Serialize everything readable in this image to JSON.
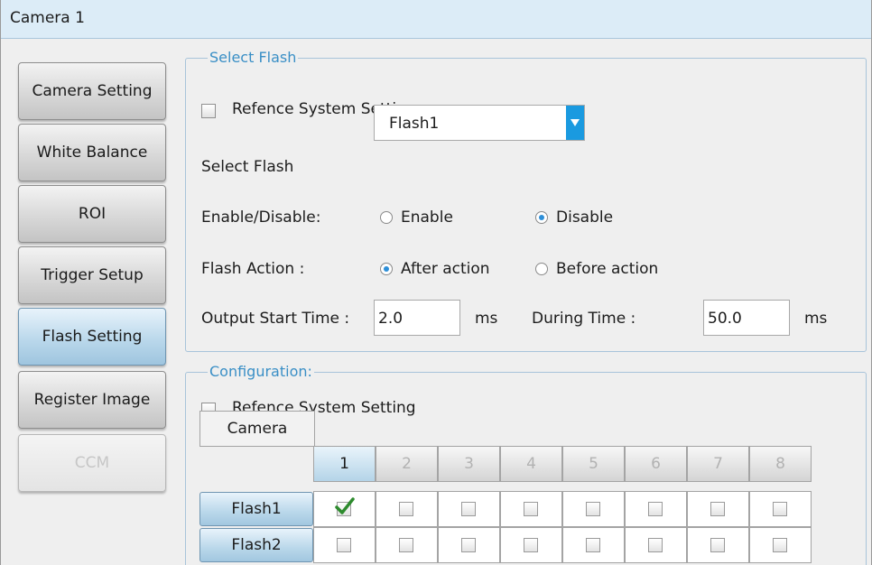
{
  "window": {
    "title": "Camera 1"
  },
  "nav": [
    {
      "label": "Camera Setting",
      "state": "normal"
    },
    {
      "label": "White Balance",
      "state": "normal"
    },
    {
      "label": "ROI",
      "state": "normal"
    },
    {
      "label": "Trigger Setup",
      "state": "normal"
    },
    {
      "label": "Flash Setting",
      "state": "selected"
    },
    {
      "label": "Register Image",
      "state": "normal"
    },
    {
      "label": "CCM",
      "state": "disabled"
    }
  ],
  "select_flash": {
    "legend": "Select Flash",
    "reference_label": "Refence System Setting",
    "reference_checked": false,
    "select_label": "Select Flash",
    "select_value": "Flash1",
    "enable_label": "Enable/Disable:",
    "enable_option": "Enable",
    "disable_option": "Disable",
    "enable_selected": "Disable",
    "action_label": "Flash Action :",
    "after_option": "After action",
    "before_option": "Before action",
    "action_selected": "After action",
    "start_label": "Output Start Time :",
    "start_value": "2.0",
    "start_unit": "ms",
    "during_label": "During Time :",
    "during_value": "50.0",
    "during_unit": "ms"
  },
  "configuration": {
    "legend": "Configuration:",
    "reference_label": "Refence System Setting",
    "reference_checked": false,
    "camera_header": "Camera",
    "columns": [
      "1",
      "2",
      "3",
      "4",
      "5",
      "6",
      "7",
      "8"
    ],
    "active_column": "1",
    "rows": [
      {
        "label": "Flash1",
        "checked": [
          true,
          false,
          false,
          false,
          false,
          false,
          false,
          false
        ]
      },
      {
        "label": "Flash2",
        "checked": [
          false,
          false,
          false,
          false,
          false,
          false,
          false,
          false
        ]
      }
    ]
  },
  "colors": {
    "accent": "#1a9ae0",
    "title_bar": "#dcecf7",
    "legend": "#3a8fc6",
    "check": "#2e8b2e"
  },
  "icons": {
    "dropdown": "triangle-down-icon",
    "checkmark": "checkmark-icon"
  }
}
